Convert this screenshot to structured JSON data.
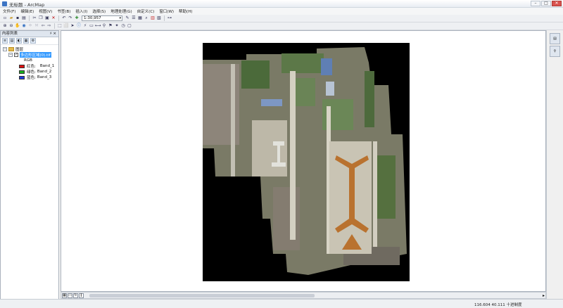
{
  "window": {
    "title": "无标题 - ArcMap",
    "controls": [
      "–",
      "□",
      "✕"
    ]
  },
  "menu": [
    "文件(F)",
    "编辑(E)",
    "视图(V)",
    "书签(B)",
    "插入(I)",
    "选择(S)",
    "地理处理(G)",
    "自定义(C)",
    "窗口(W)",
    "帮助(H)"
  ],
  "toolbar": {
    "scale": "1:30,957"
  },
  "toc": {
    "title": "内容列表",
    "pin": "♯ ×",
    "group": "图层",
    "layer": "多边形区域(0).tif",
    "renderer": "RGB",
    "bands": [
      {
        "label": "红色:",
        "band": "Band_1",
        "color": "#e01010"
      },
      {
        "label": "绿色:",
        "band": "Band_2",
        "color": "#16b21e"
      },
      {
        "label": "蓝色:",
        "band": "Band_3",
        "color": "#1f3ee0"
      }
    ]
  },
  "status": {
    "coordinates": "116.604  40.111  十进制度"
  },
  "colors": {
    "terminal_accent": "#b9722f",
    "background": "#000000",
    "vegetation": "#4b6a3a"
  }
}
